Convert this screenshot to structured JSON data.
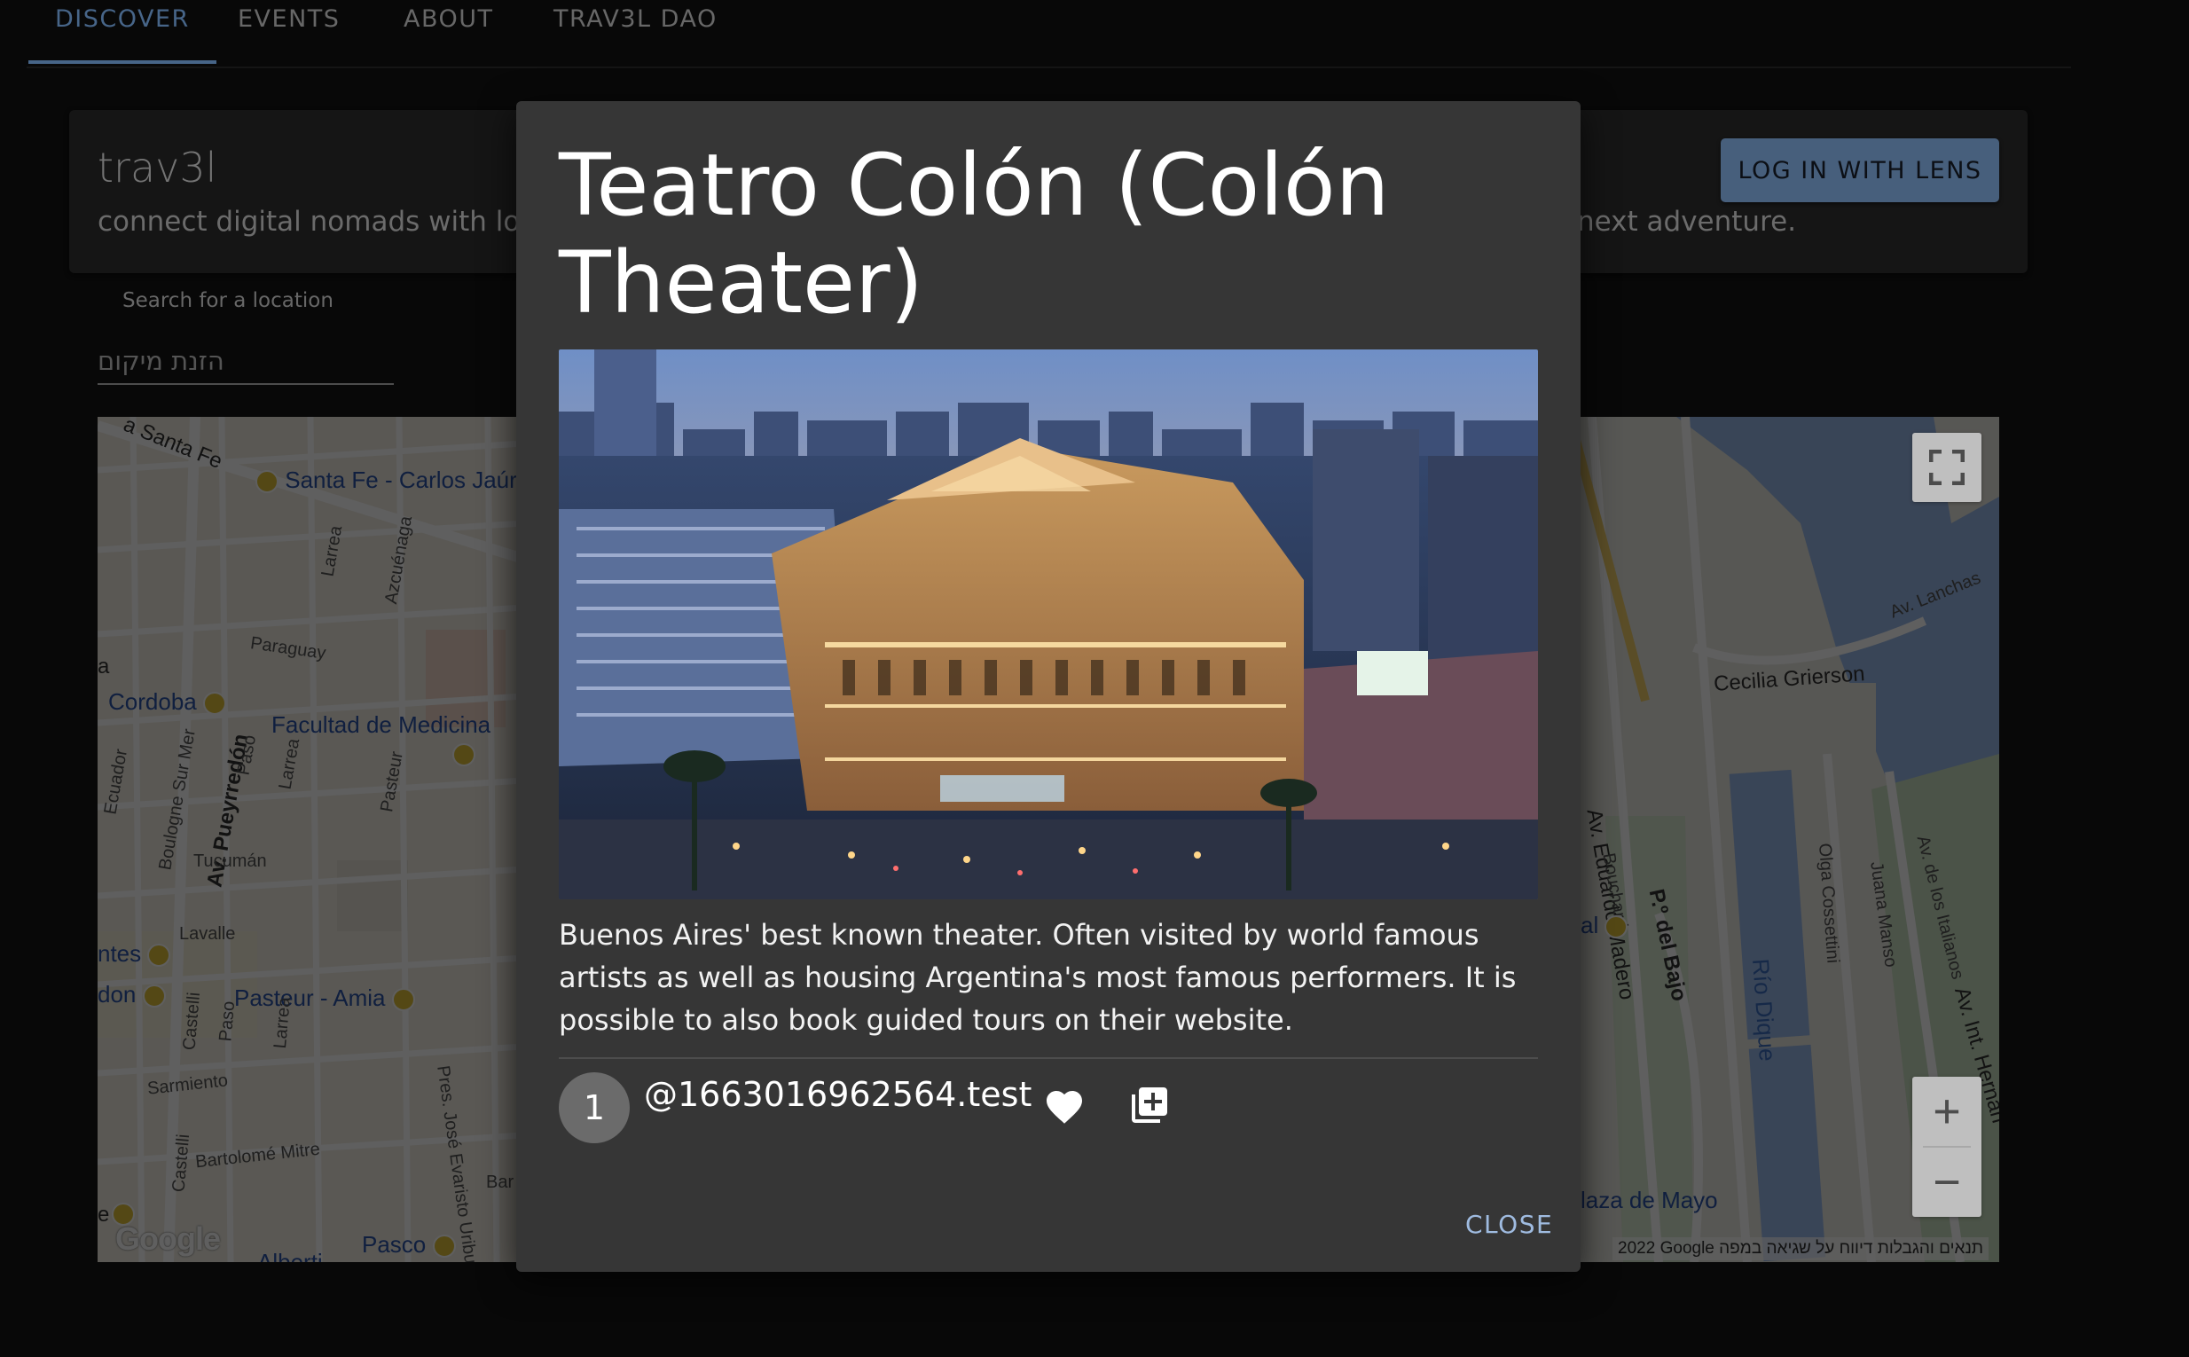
{
  "nav": {
    "tabs": [
      {
        "label": "DISCOVER",
        "active": true
      },
      {
        "label": "EVENTS",
        "active": false
      },
      {
        "label": "ABOUT",
        "active": false
      },
      {
        "label": "TRAV3L DAO",
        "active": false
      }
    ]
  },
  "header": {
    "title": "trav3l",
    "tagline_visible_left": "connect digital nomads with loca",
    "tagline_visible_right": "next adventure.",
    "login_label": "LOG IN WITH LENS"
  },
  "search": {
    "label": "Search for a location",
    "placeholder": "הזנת מיקום",
    "value": ""
  },
  "map": {
    "labels": {
      "santa_fe_av": "a Santa Fe",
      "santa_fe_station": "Santa Fe - Carlos Jaúre",
      "larrea_1": "Larrea",
      "azcuenaga": "Azcuénaga",
      "paraguay": "Paraguay",
      "a_edge": "a",
      "cordoba": "Cordoba",
      "facultad": "Facultad de Medicina",
      "ecuador": "Ecuador",
      "boulogne": "Boulogne Sur Mer",
      "pueyrredon": "Av. Pueyrredón",
      "paso_1": "Paso",
      "larrea_2": "Larrea",
      "pasteur": "Pasteur",
      "tucuman": "Tucumán",
      "lavalle": "Lavalle",
      "ntes": "ntes",
      "don": "don",
      "pasteur_amia": "Pasteur - Amia",
      "castelli": "Castelli",
      "paso_2": "Paso",
      "larrea_3": "Larrea",
      "pres_uriburu": "Pres. José Evaristo Uriburu",
      "sarmiento": "Sarmiento",
      "bartolome": "Bartolomé Mitre",
      "castelli_2": "Castelli",
      "bar": "Bar",
      "pasco": "Pasco",
      "alberti": "Alberti",
      "e_edge": "e",
      "av_lanchas": "Av. Lanchas",
      "cecilia": "Cecilia Grierson",
      "eduardo_madero": "Av. Eduardo Madero",
      "bouchard": "Bouchard",
      "p_del_bajo": "P.º del Bajo",
      "olga": "Olga Cossettini",
      "juana_manso": "Juana Manso",
      "av_italianos": "Av. de los Italianos",
      "av_int_hernan": "Av. Int. Hernan",
      "al_edge": "al",
      "rio_dique": "Río Dique",
      "plaza_mayo": "laza de Mayo"
    },
    "attribution": "2022 Google   תנאים והגבלות   דיווח על שגיאה במפה",
    "google_logo": "Google",
    "zoom_in": "+",
    "zoom_out": "−"
  },
  "modal": {
    "title": "Teatro Colón (Colón Theater)",
    "description": "Buenos Aires' best known theater. Often visited by world famous artists as well as housing Argentina's most famous performers. It is possible to also book guided tours on their website.",
    "avatar_text": "1",
    "username": "@1663016962564.test",
    "close_label": "CLOSE",
    "icons": {
      "like": "heart-icon",
      "add": "add-to-collection-icon"
    }
  },
  "colors": {
    "accent": "#5f87b6",
    "login_bg": "#5f7fa6",
    "modal_bg": "#363636",
    "close_text": "#9fbbe0"
  }
}
